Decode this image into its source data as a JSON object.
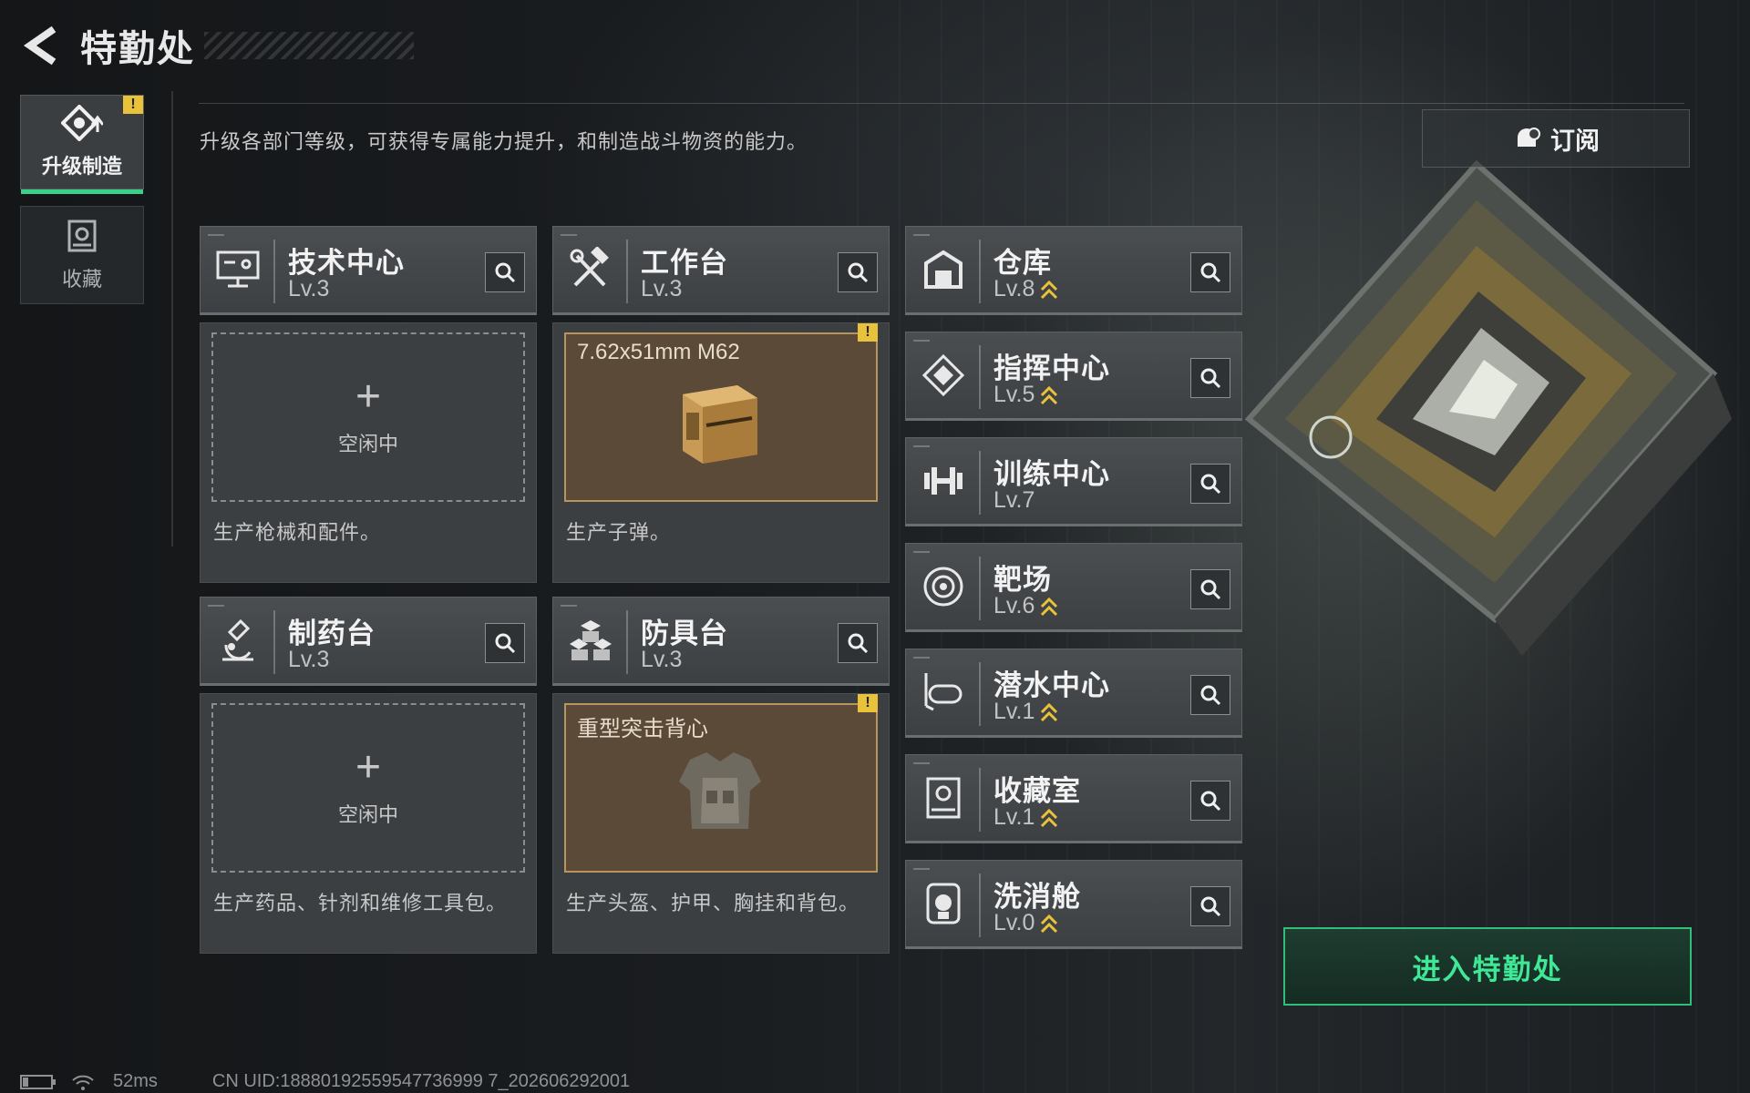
{
  "header": {
    "title": "特勤处"
  },
  "sidebar": {
    "tabs": [
      {
        "label": "升级制造",
        "active": true,
        "icon": "upgrade-icon",
        "warning": "!"
      },
      {
        "label": "收藏",
        "active": false,
        "icon": "collection-icon"
      }
    ]
  },
  "main": {
    "description": "升级各部门等级，可获得专属能力提升，和制造战斗物资的能力。",
    "subscribe_label": "订阅",
    "workshops": [
      {
        "name": "技术中心",
        "level": "Lv.3",
        "icon": "tech-monitor-icon",
        "status": "empty",
        "idle_label": "空闲中",
        "desc": "生产枪械和配件。"
      },
      {
        "name": "工作台",
        "level": "Lv.3",
        "icon": "hammer-wrench-icon",
        "status": "producing",
        "item": "7.62x51mm M62",
        "warning": "!",
        "desc": "生产子弹。"
      },
      {
        "name": "制药台",
        "level": "Lv.3",
        "icon": "microscope-icon",
        "status": "empty",
        "idle_label": "空闲中",
        "desc": "生产药品、针剂和维修工具包。"
      },
      {
        "name": "防具台",
        "level": "Lv.3",
        "icon": "armor-blocks-icon",
        "status": "producing",
        "item": "重型突击背心",
        "warning": "!",
        "desc": "生产头盔、护甲、胸挂和背包。"
      }
    ],
    "facilities": [
      {
        "name": "仓库",
        "level": "Lv.8",
        "upgradable": true,
        "icon": "warehouse-icon"
      },
      {
        "name": "指挥中心",
        "level": "Lv.5",
        "upgradable": true,
        "icon": "command-diamond-icon"
      },
      {
        "name": "训练中心",
        "level": "Lv.7",
        "upgradable": false,
        "icon": "dumbbell-icon"
      },
      {
        "name": "靶场",
        "level": "Lv.6",
        "upgradable": true,
        "icon": "target-icon"
      },
      {
        "name": "潜水中心",
        "level": "Lv.1",
        "upgradable": true,
        "icon": "diving-mask-icon"
      },
      {
        "name": "收藏室",
        "level": "Lv.1",
        "upgradable": true,
        "icon": "collection-room-icon"
      },
      {
        "name": "洗消舱",
        "level": "Lv.0",
        "upgradable": true,
        "icon": "decon-chamber-icon"
      }
    ],
    "enter_button": "进入特勤处"
  },
  "statusbar": {
    "ping": "52ms",
    "uid": "CN UID:18880192559547736999 7_202606292001"
  },
  "colors": {
    "accent": "#39d08a",
    "upgrade": "#e8c23a",
    "item_bg": "#5b4a38"
  }
}
